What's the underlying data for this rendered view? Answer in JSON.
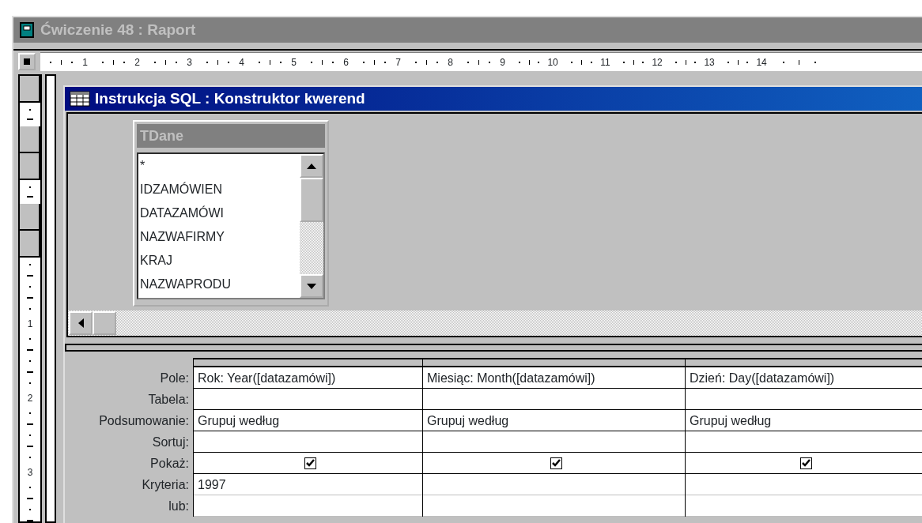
{
  "window": {
    "title": "Ćwiczenie 48 : Raport"
  },
  "ruler": {
    "labels": [
      "1",
      "2",
      "3",
      "4",
      "5",
      "6",
      "7",
      "8",
      "9",
      "10",
      "11",
      "12",
      "13",
      "14"
    ]
  },
  "vertical_ruler": {
    "labels": [
      "1",
      "2",
      "3"
    ]
  },
  "query_window": {
    "title": "Instrukcja SQL : Konstruktor kwerend"
  },
  "table": {
    "title": "TDane",
    "fields": [
      "*",
      "IDZAMÓWIEN",
      "DATAZAMÓWI",
      "NAZWAFIRMY",
      "KRAJ",
      "NAZWAPRODU"
    ]
  },
  "grid": {
    "row_labels": [
      "Pole:",
      "Tabela:",
      "Podsumowanie:",
      "Sortuj:",
      "Pokaż:",
      "Kryteria:",
      "lub:"
    ],
    "columns": [
      {
        "field": "Rok: Year([datazamówi])",
        "total": "Grupuj według",
        "show": true,
        "criteria": "1997"
      },
      {
        "field": "Miesiąc: Month([datazamówi])",
        "total": "Grupuj według",
        "show": true
      },
      {
        "field": "Dzień: Day([datazamówi])",
        "total": "Grupuj według",
        "show": true
      }
    ]
  }
}
